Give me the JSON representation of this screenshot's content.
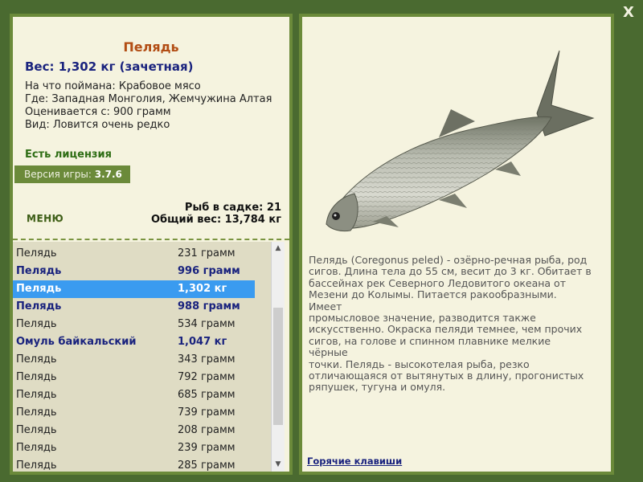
{
  "close_label": "X",
  "fish_card": {
    "name": "Пелядь",
    "weight_line": "Вес: 1,302 кг (зачетная)",
    "caught_on": "На что поймана: Крабовое мясо",
    "location": "Где: Западная Монголия, Жемчужина Алтая",
    "valued_from": "Оценивается с: 900 грамм",
    "rarity": "Вид: Ловится очень редко"
  },
  "license_text": "Есть лицензия",
  "version": {
    "label": "Версия игры:",
    "value": "3.7.6"
  },
  "menu_label": "МЕНЮ",
  "stats": {
    "fish_in_net": "Рыб в садке: 21",
    "total_weight": "Общий вес: 13,784 кг"
  },
  "catch_list": [
    {
      "name": "Пелядь",
      "weight": "231 грамм",
      "style": "normal"
    },
    {
      "name": "Пелядь",
      "weight": "996 грамм",
      "style": "bold"
    },
    {
      "name": "Пелядь",
      "weight": "1,302 кг",
      "style": "selected"
    },
    {
      "name": "Пелядь",
      "weight": "988 грамм",
      "style": "bold"
    },
    {
      "name": "Пелядь",
      "weight": "534 грамм",
      "style": "normal"
    },
    {
      "name": "Омуль байкальский",
      "weight": "1,047 кг",
      "style": "bold"
    },
    {
      "name": "Пелядь",
      "weight": "343 грамм",
      "style": "normal"
    },
    {
      "name": "Пелядь",
      "weight": "792 грамм",
      "style": "normal"
    },
    {
      "name": "Пелядь",
      "weight": "685 грамм",
      "style": "normal"
    },
    {
      "name": "Пелядь",
      "weight": "739 грамм",
      "style": "normal"
    },
    {
      "name": "Пелядь",
      "weight": "208 грамм",
      "style": "normal"
    },
    {
      "name": "Пелядь",
      "weight": "239 грамм",
      "style": "normal"
    },
    {
      "name": "Пелядь",
      "weight": "285 грамм",
      "style": "normal"
    }
  ],
  "description_lines": [
    "Пелядь (Coregonus peled) - озёрно-речная рыба, род",
    "сигов. Длина тела до 55 см, весит до 3 кг. Обитает в",
    "бассейнах рек Северного Ледовитого океана от",
    "Мезени до Колымы. Питается ракообразными. Имеет",
    "промысловое значение, разводится также",
    "искусственно. Окраска пеляди темнее, чем прочих",
    "сигов, на голове и спинном плавнике мелкие чёрные",
    "точки. Пелядь - высокотелая рыба, резко",
    "отличающаяся от вытянутых в длину, прогонистых",
    "ряпушек, тугуна и омуля."
  ],
  "hotkeys_label": "Горячие клавиши",
  "colors": {
    "frame_green": "#6b8a3a",
    "title_orange": "#b24d14",
    "weight_navy": "#1a237e",
    "license_green": "#2e6d14",
    "selected_blue": "#3a9bf0"
  }
}
